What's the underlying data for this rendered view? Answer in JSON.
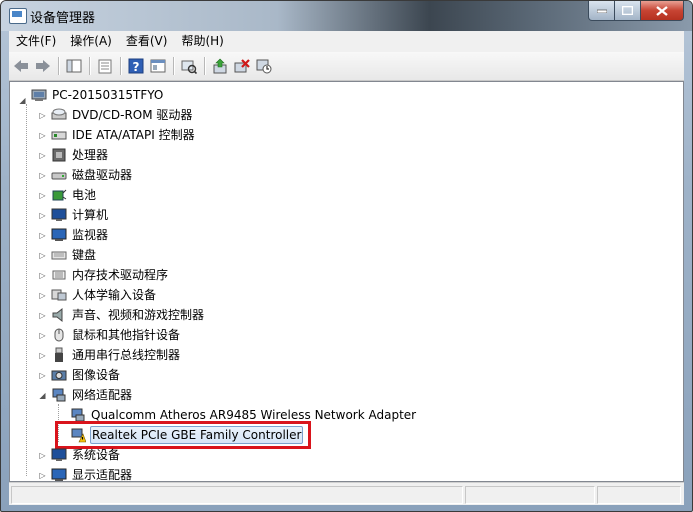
{
  "window": {
    "title": "设备管理器"
  },
  "menu": [
    {
      "label": "文件(F)"
    },
    {
      "label": "操作(A)"
    },
    {
      "label": "查看(V)"
    },
    {
      "label": "帮助(H)"
    }
  ],
  "toolbar": [
    "back-icon",
    "forward-icon",
    "console-tree-icon",
    "properties-icon",
    "help-icon",
    "view-icon",
    "scan-hardware-icon",
    "update-driver-icon",
    "uninstall-icon",
    "disable-device-icon"
  ],
  "tree": {
    "root": "PC-20150315TFYO",
    "categories": [
      {
        "label": "DVD/CD-ROM 驱动器",
        "icon": "dvd-drive-icon"
      },
      {
        "label": "IDE ATA/ATAPI 控制器",
        "icon": "ide-controller-icon"
      },
      {
        "label": "处理器",
        "icon": "processor-icon"
      },
      {
        "label": "磁盘驱动器",
        "icon": "disk-drive-icon"
      },
      {
        "label": "电池",
        "icon": "battery-icon"
      },
      {
        "label": "计算机",
        "icon": "computer-icon"
      },
      {
        "label": "监视器",
        "icon": "monitor-icon"
      },
      {
        "label": "键盘",
        "icon": "keyboard-icon"
      },
      {
        "label": "内存技术驱动程序",
        "icon": "memory-tech-icon"
      },
      {
        "label": "人体学输入设备",
        "icon": "hid-icon"
      },
      {
        "label": "声音、视频和游戏控制器",
        "icon": "sound-icon"
      },
      {
        "label": "鼠标和其他指针设备",
        "icon": "mouse-icon"
      },
      {
        "label": "通用串行总线控制器",
        "icon": "usb-icon"
      },
      {
        "label": "图像设备",
        "icon": "imaging-icon"
      },
      {
        "label": "网络适配器",
        "icon": "network-adapter-icon",
        "expanded": true,
        "children": [
          {
            "label": "Qualcomm Atheros AR9485 Wireless Network Adapter",
            "icon": "network-card-icon"
          },
          {
            "label": "Realtek PCIe GBE Family Controller",
            "icon": "network-card-warning-icon",
            "selected": true
          }
        ]
      },
      {
        "label": "系统设备",
        "icon": "system-device-icon"
      },
      {
        "label": "显示适配器",
        "icon": "display-adapter-icon"
      }
    ]
  },
  "colors": {
    "highlight_box": "#d9141c",
    "selection": "#d6e6f8"
  }
}
